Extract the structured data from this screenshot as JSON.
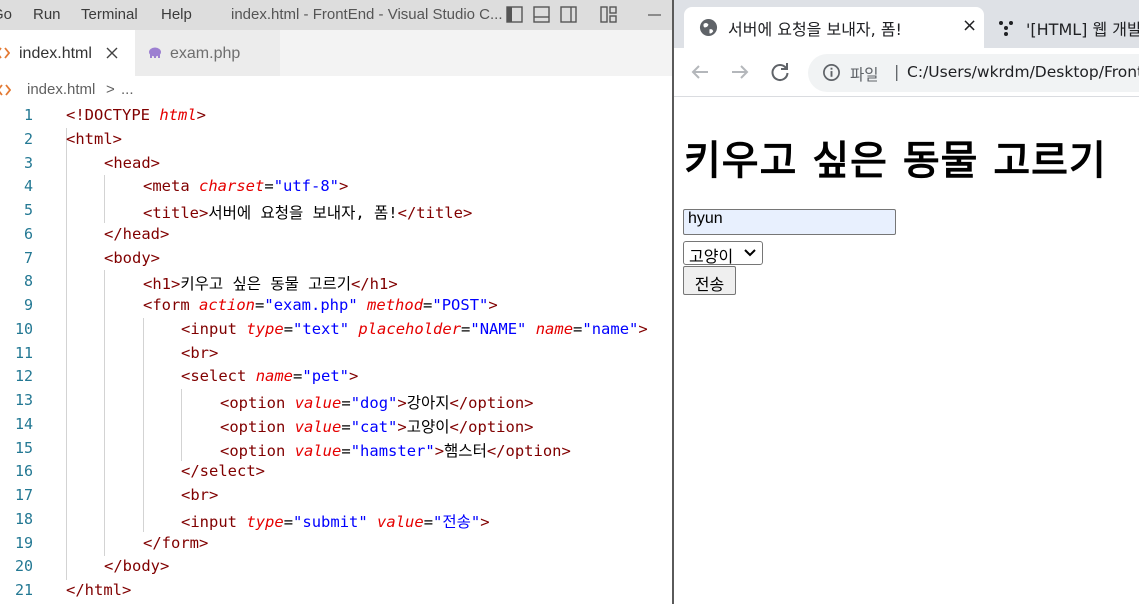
{
  "vscode": {
    "menu": [
      "Go",
      "Run",
      "Terminal",
      "Help"
    ],
    "window_title": "index.html - FrontEnd - Visual Studio C...",
    "tabs": [
      {
        "label": "index.html",
        "icon": "html-file-icon",
        "active": true
      },
      {
        "label": "exam.php",
        "icon": "php-elephant-icon",
        "active": false
      }
    ],
    "breadcrumb": {
      "file": "index.html",
      "separator": ">",
      "rest": "..."
    },
    "line_numbers": [
      "1",
      "2",
      "3",
      "4",
      "5",
      "6",
      "7",
      "8",
      "9",
      "10",
      "11",
      "12",
      "13",
      "14",
      "15",
      "16",
      "17",
      "18",
      "19",
      "20",
      "21"
    ],
    "code": {
      "l1": {
        "open": "<!DOCTYPE ",
        "attr": "html",
        "close": ">"
      },
      "l2": {
        "open": "<",
        "tag": "html",
        "close": ">"
      },
      "l3": {
        "open": "<",
        "tag": "head",
        "close": ">"
      },
      "l4": {
        "open": "<",
        "tag": "meta",
        "attr1": "charset",
        "eq1": "=",
        "val1": "\"utf-8\"",
        "close": ">"
      },
      "l5": {
        "open": "<",
        "tag": "title",
        "close": ">",
        "text": "서버에 요청을 보내자, 폼!",
        "end_open": "</",
        "end_tag": "title",
        "end_close": ">"
      },
      "l6": {
        "open": "</",
        "tag": "head",
        "close": ">"
      },
      "l7": {
        "open": "<",
        "tag": "body",
        "close": ">"
      },
      "l8": {
        "open": "<",
        "tag": "h1",
        "close": ">",
        "text": "키우고 싶은 동물 고르기",
        "end_open": "</",
        "end_tag": "h1",
        "end_close": ">"
      },
      "l9": {
        "open": "<",
        "tag": "form",
        "attr1": "action",
        "eq1": "=",
        "val1": "\"exam.php\"",
        "attr2": "method",
        "eq2": "=",
        "val2": "\"POST\"",
        "close": ">"
      },
      "l10": {
        "open": "<",
        "tag": "input",
        "attr1": "type",
        "eq1": "=",
        "val1": "\"text\"",
        "attr2": "placeholder",
        "eq2": "=",
        "val2": "\"NAME\"",
        "attr3": "name",
        "eq3": "=",
        "val3": "\"name\"",
        "close": ">"
      },
      "l11": {
        "open": "<",
        "tag": "br",
        "close": ">"
      },
      "l12": {
        "open": "<",
        "tag": "select",
        "attr1": "name",
        "eq1": "=",
        "val1": "\"pet\"",
        "close": ">"
      },
      "l13": {
        "open": "<",
        "tag": "option",
        "attr1": "value",
        "eq1": "=",
        "val1": "\"dog\"",
        "close": ">",
        "text": "강아지",
        "end_open": "</",
        "end_tag": "option",
        "end_close": ">"
      },
      "l14": {
        "open": "<",
        "tag": "option",
        "attr1": "value",
        "eq1": "=",
        "val1": "\"cat\"",
        "close": ">",
        "text": "고양이",
        "end_open": "</",
        "end_tag": "option",
        "end_close": ">"
      },
      "l15": {
        "open": "<",
        "tag": "option",
        "attr1": "value",
        "eq1": "=",
        "val1": "\"hamster\"",
        "close": ">",
        "text": "햄스터",
        "end_open": "</",
        "end_tag": "option",
        "end_close": ">"
      },
      "l16": {
        "open": "</",
        "tag": "select",
        "close": ">"
      },
      "l17": {
        "open": "<",
        "tag": "br",
        "close": ">"
      },
      "l18": {
        "open": "<",
        "tag": "input",
        "attr1": "type",
        "eq1": "=",
        "val1": "\"submit\"",
        "attr2": "value",
        "eq2": "=",
        "val2": "\"전송\"",
        "close": ">"
      },
      "l19": {
        "open": "</",
        "tag": "form",
        "close": ">"
      },
      "l20": {
        "open": "</",
        "tag": "body",
        "close": ">"
      },
      "l21": {
        "open": "</",
        "tag": "html",
        "close": ">"
      }
    }
  },
  "chrome": {
    "tabs": [
      {
        "title": "서버에 요청을 보내자, 폼!",
        "icon": "globe-icon",
        "close": "×",
        "active": true
      },
      {
        "title": "'[HTML] 웹 개발",
        "icon": "dots-favicon-icon",
        "active": false
      }
    ],
    "omnibox": {
      "scheme_label": "파일",
      "separator": "|",
      "url": "C:/Users/wkrdm/Desktop/Front"
    },
    "page": {
      "heading": "키우고 싶은 동물 고르기",
      "name_input_value": "hyun",
      "name_input_placeholder": "NAME",
      "pet_selected": "고양이",
      "submit_label": "전송"
    }
  },
  "colors": {
    "vscode_titlebar": "#dddddd",
    "vscode_tag": "#800000",
    "vscode_attr": "#e50000",
    "vscode_string": "#0000ff",
    "vscode_line_number": "#237893",
    "chrome_tabstrip": "#dee1e6",
    "autofill_bg": "#e8f0fe"
  }
}
